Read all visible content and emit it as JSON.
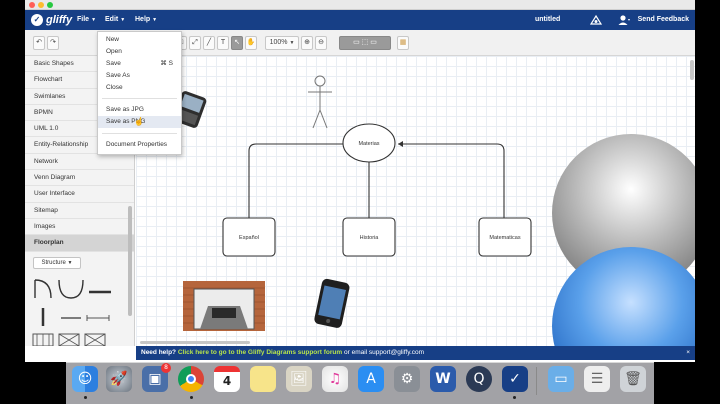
{
  "app": {
    "logo_text": "gliffy",
    "document_title": "untitled",
    "feedback_label": "Send Feedback"
  },
  "menubar": {
    "file_label": "File",
    "edit_label": "Edit",
    "help_label": "Help"
  },
  "toolbar": {
    "zoom_label": "100%"
  },
  "file_menu": {
    "items": [
      "New",
      "Open",
      "Save",
      "Save As",
      "Close",
      "Save as JPG",
      "Save as PNG",
      "Document Properties"
    ],
    "save_shortcut": "⌘ S",
    "highlighted": "Save as PNG"
  },
  "sidebar": {
    "categories": [
      "Basic Shapes",
      "Flowchart",
      "Swimlanes",
      "BPMN",
      "UML 1.0",
      "Entity-Relationship",
      "Network",
      "Venn Diagram",
      "User Interface",
      "Sitemap",
      "Images",
      "Floorplan"
    ],
    "active": "Floorplan",
    "structure_label": "Structure"
  },
  "diagram": {
    "root_label": "Materias",
    "child_labels": [
      "Español",
      "Historia",
      "Matematicas"
    ]
  },
  "helpbar": {
    "need_help": "Need help?",
    "link_text": "Click here to go to the Gliffy Diagrams support forum",
    "suffix": "or email support@gliffy.com",
    "close": "×"
  },
  "colors": {
    "brand_blue": "#173f86",
    "help_link_green": "#b7e34b",
    "sphere_gray": "#9c9c9c",
    "sphere_blue": "#3f86d6"
  },
  "icons": {
    "dock": [
      "finder-icon",
      "launchpad-icon",
      "photo-preview-icon",
      "chrome-icon",
      "calendar-icon",
      "notes-icon",
      "preview-icon",
      "itunes-icon",
      "app-store-icon",
      "system-preferences-icon",
      "word-icon",
      "quicktime-icon",
      "gliffy-icon",
      "folder-icon",
      "documents-icon",
      "trash-icon"
    ]
  },
  "dock": {
    "calendar_day": "4",
    "notification_badge": "8"
  }
}
